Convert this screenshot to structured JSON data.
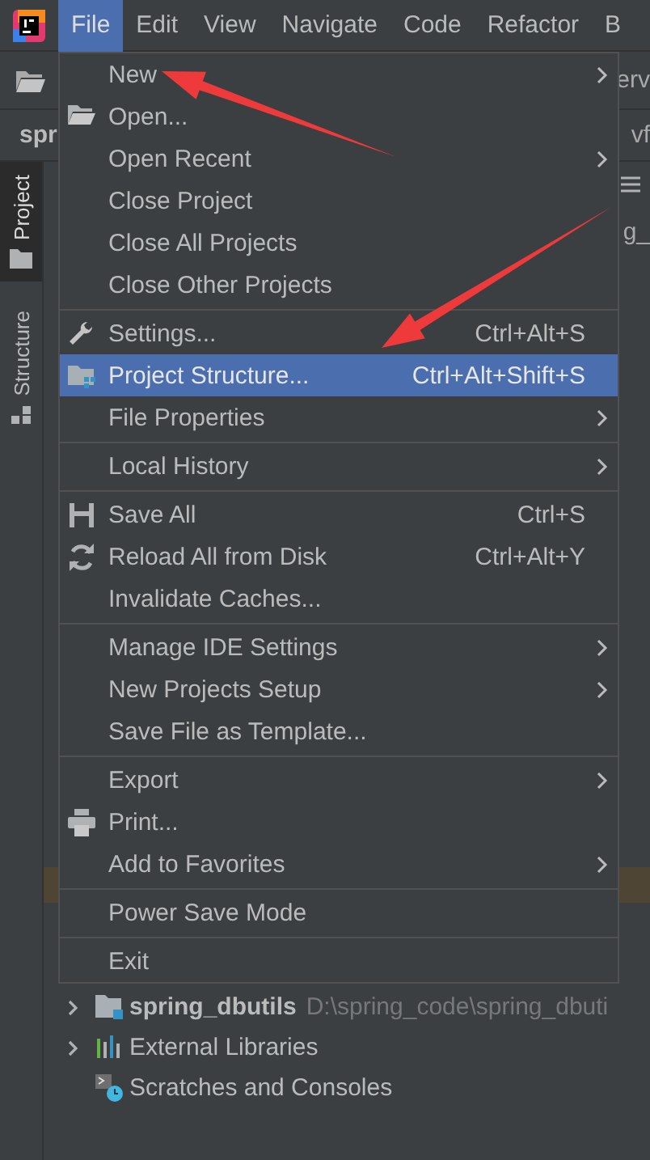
{
  "menu_bar": [
    {
      "label": "File",
      "selected": true
    },
    {
      "label": "Edit",
      "selected": false
    },
    {
      "label": "View",
      "selected": false
    },
    {
      "label": "Navigate",
      "selected": false
    },
    {
      "label": "Code",
      "selected": false
    },
    {
      "label": "Refactor",
      "selected": false
    },
    {
      "label": "B",
      "selected": false
    }
  ],
  "toolbar": {
    "text": "erv"
  },
  "nav_bar": {
    "text": "spr",
    "text_right": "vf"
  },
  "side_tabs": [
    {
      "label": "Project",
      "selected": true
    },
    {
      "label": "Structure",
      "selected": false
    }
  ],
  "project_tree": {
    "partial_text": "g_",
    "rows": [
      {
        "name": "spring_dbutils",
        "path": "D:\\spring_code\\spring_dbuti",
        "expanded": false
      },
      {
        "name": "External Libraries",
        "expanded": false
      },
      {
        "name": "Scratches and Consoles"
      }
    ]
  },
  "file_menu": {
    "sections": [
      [
        {
          "label": "New",
          "submenu": true,
          "selected": false
        },
        {
          "label": "Open...",
          "submenu": false,
          "selected": false
        },
        {
          "label": "Open Recent",
          "submenu": true,
          "selected": false
        },
        {
          "label": "Close Project",
          "submenu": false,
          "selected": false
        },
        {
          "label": "Close All Projects",
          "submenu": false,
          "selected": false
        },
        {
          "label": "Close Other Projects",
          "submenu": false,
          "selected": false
        }
      ],
      [
        {
          "label": "Settings...",
          "shortcut": "Ctrl+Alt+S",
          "submenu": false,
          "selected": false
        },
        {
          "label": "Project Structure...",
          "shortcut": "Ctrl+Alt+Shift+S",
          "submenu": false,
          "selected": true
        },
        {
          "label": "File Properties",
          "submenu": true,
          "selected": false
        }
      ],
      [
        {
          "label": "Local History",
          "submenu": true,
          "selected": false
        }
      ],
      [
        {
          "label": "Save All",
          "shortcut": "Ctrl+S",
          "submenu": false,
          "selected": false
        },
        {
          "label": "Reload All from Disk",
          "shortcut": "Ctrl+Alt+Y",
          "submenu": false,
          "selected": false
        },
        {
          "label": "Invalidate Caches...",
          "submenu": false,
          "selected": false
        }
      ],
      [
        {
          "label": "Manage IDE Settings",
          "submenu": true,
          "selected": false
        },
        {
          "label": "New Projects Setup",
          "submenu": true,
          "selected": false
        },
        {
          "label": "Save File as Template...",
          "submenu": false,
          "selected": false
        }
      ],
      [
        {
          "label": "Export",
          "submenu": true,
          "selected": false
        },
        {
          "label": "Print...",
          "submenu": false,
          "selected": false
        },
        {
          "label": "Add to Favorites",
          "submenu": true,
          "selected": false
        }
      ],
      [
        {
          "label": "Power Save Mode",
          "submenu": false,
          "selected": false
        }
      ],
      [
        {
          "label": "Exit",
          "submenu": false,
          "selected": false
        }
      ]
    ]
  },
  "annotations": [
    {
      "kind": "arrow"
    },
    {
      "kind": "arrow"
    }
  ]
}
